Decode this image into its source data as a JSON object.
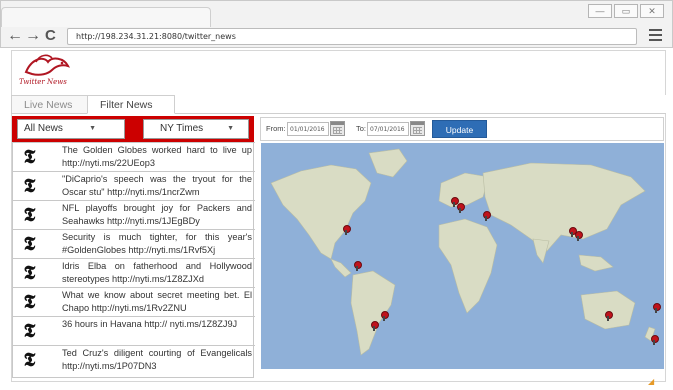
{
  "browser": {
    "url": "http://198.234.31.21:8080/twitter_news",
    "back_glyph": "←",
    "forward_glyph": "→",
    "reload_glyph": "C",
    "win_minimize": "—",
    "win_maximize": "▭",
    "win_close": "✕"
  },
  "logo": {
    "text": "Twitter News"
  },
  "tabs": [
    {
      "label": "Live News",
      "active": false
    },
    {
      "label": "Filter News",
      "active": true
    }
  ],
  "filters": {
    "news_select": "All News",
    "source_select": "NY Times",
    "from_label": "From:",
    "from_value": "01/01/2016",
    "to_label": "To:",
    "to_value": "07/01/2016",
    "update_label": "Update"
  },
  "news_icon_glyph": "𝕿",
  "news": [
    {
      "text": "The Golden Globes worked hard to live up http://nyti.ms/22UEop3"
    },
    {
      "text": "\"DiCaprio's speech was the tryout for the Oscar stu\" http://nyti.ms/1ncrZwm"
    },
    {
      "text": "NFL playoffs brought joy for Packers and Seahawks http://nyti.ms/1JEgBDy"
    },
    {
      "text": "Security is much tighter, for this year's #GoldenGlobes http://nyti.ms/1Rvf5Xj"
    },
    {
      "text": "Idris Elba on fatherhood and Hollywood stereotypes http://nyti.ms/1Z8ZJXd"
    },
    {
      "text": "What we know about secret meeting bet. El Chapo http://nyti.ms/1Rv2ZNU"
    },
    {
      "text": "36 hours in Havana http:// nyti.ms/1Z8ZJ9J"
    },
    {
      "text": "Ted Cruz's diligent courting of Evangelicals http://nyti.ms/1P07DN3"
    }
  ],
  "colors": {
    "filter_bar": "#cc0000",
    "ocean": "#8fb0d8",
    "land": "#d9dcc4",
    "pin": "#c0121c",
    "update_button": "#2e6db5"
  }
}
